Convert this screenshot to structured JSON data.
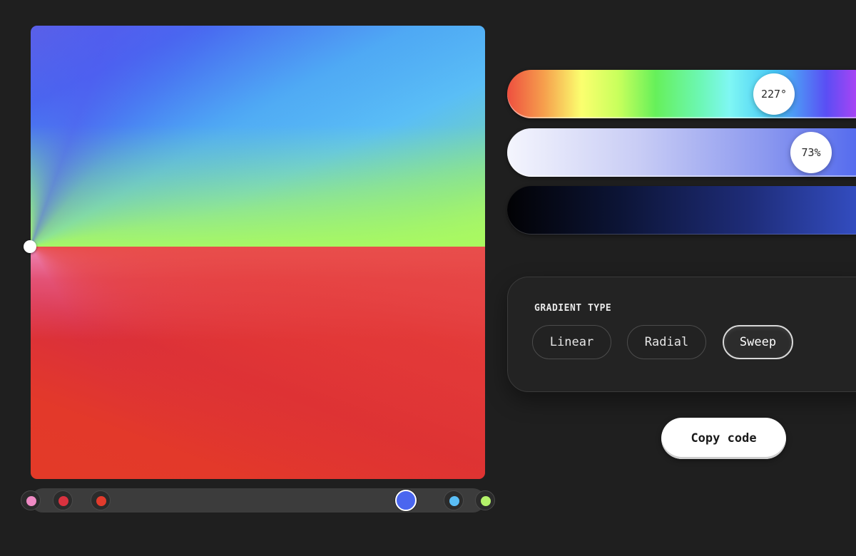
{
  "canvas": {
    "top_colors": [
      "#4a66ef",
      "#5abef6",
      "#a9f06a"
    ],
    "bottom_colors": [
      "#e8608f",
      "#d92e3e",
      "#e33a28"
    ]
  },
  "color_stops": [
    {
      "color": "#ef8ac4",
      "active": false
    },
    {
      "color": "#d9323f",
      "active": false
    },
    {
      "color": "#e23b2c",
      "active": false
    },
    {
      "color": "#4a66ef",
      "active": true
    },
    {
      "color": "#5abef6",
      "active": false
    },
    {
      "color": "#b4f26a",
      "active": false
    }
  ],
  "sliders": {
    "hue": {
      "value": 227,
      "display": "227°"
    },
    "saturation": {
      "value": 73,
      "display": "73%"
    },
    "lightness": {
      "value": null,
      "display": ""
    }
  },
  "gradient_type": {
    "label": "GRADIENT TYPE",
    "options": [
      "Linear",
      "Radial",
      "Sweep"
    ],
    "selected": "Sweep"
  },
  "copy_button": {
    "label": "Copy code"
  }
}
